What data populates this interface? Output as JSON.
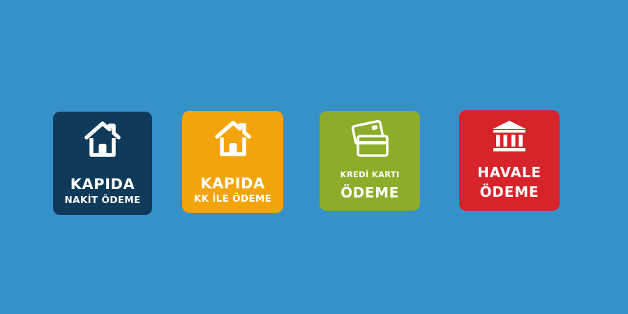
{
  "colors": {
    "background": "#3591c7",
    "tile_navy": "#0f3a5a",
    "tile_orange": "#f4a40b",
    "tile_green": "#8cad2a",
    "tile_red": "#d7232a",
    "foreground": "#ffffff"
  },
  "tiles": [
    {
      "icon": "house-icon",
      "line1": "KAPIDA",
      "line2": "NAKİT ÖDEME"
    },
    {
      "icon": "house-icon",
      "line1": "KAPIDA",
      "line2": "KK İLE ÖDEME"
    },
    {
      "icon": "credit-cards-icon",
      "line1": "KREDİ KARTI",
      "line2": "ÖDEME"
    },
    {
      "icon": "bank-icon",
      "line1": "HAVALE",
      "line2": "ÖDEME"
    }
  ]
}
